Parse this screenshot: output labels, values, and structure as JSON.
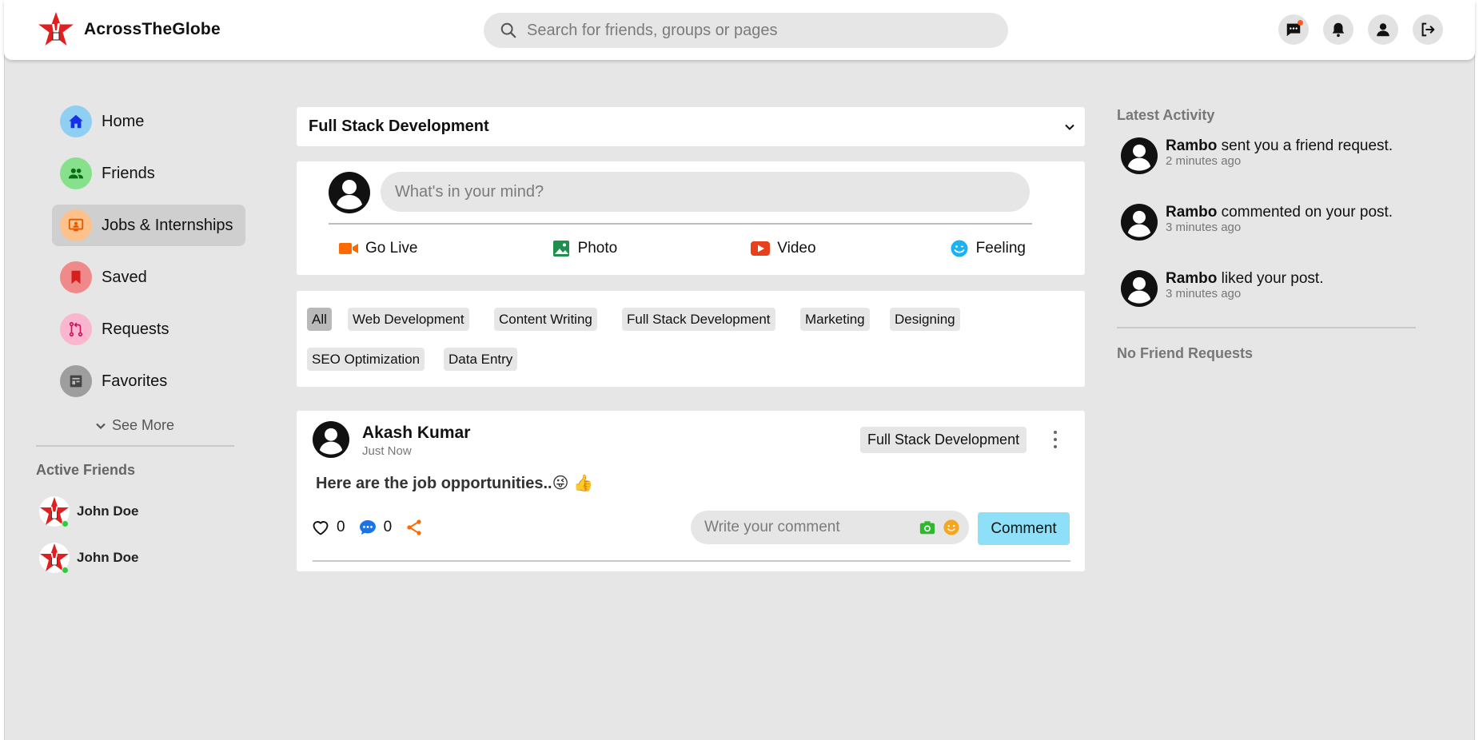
{
  "brand": {
    "name": "AcrossTheGlobe"
  },
  "search": {
    "placeholder": "Search for friends, groups or pages"
  },
  "top_icons": [
    "messages-icon",
    "bell-icon",
    "user-icon",
    "logout-icon"
  ],
  "colors": {
    "background": "#e6e6e6",
    "accent_comment": "#8de0f7",
    "go_live": "#ff6a00",
    "photo": "#1f8f4e",
    "video": "#e8401c",
    "feeling": "#1ab2f5",
    "share": "#ff6a00",
    "comment_icon": "#1a73e8",
    "online": "#2ecc40"
  },
  "nav": {
    "items": [
      {
        "label": "Home",
        "icon": "home-icon"
      },
      {
        "label": "Friends",
        "icon": "friends-icon"
      },
      {
        "label": "Jobs & Internships",
        "icon": "jobs-icon",
        "active": true
      },
      {
        "label": "Saved",
        "icon": "bookmark-icon"
      },
      {
        "label": "Requests",
        "icon": "requests-icon"
      },
      {
        "label": "Favorites",
        "icon": "favorites-icon"
      }
    ],
    "see_more": "See More"
  },
  "active_friends": {
    "title": "Active Friends",
    "friends": [
      {
        "name": "John Doe",
        "online": true
      },
      {
        "name": "John Doe",
        "online": true
      }
    ]
  },
  "feed": {
    "selected_category": "Full Stack Development",
    "composer": {
      "placeholder": "What's in your mind?",
      "actions": [
        "Go Live",
        "Photo",
        "Video",
        "Feeling"
      ]
    },
    "tags": [
      "All",
      "Web Development",
      "Content Writing",
      "Full Stack Development",
      "Marketing",
      "Designing",
      "SEO Optimization",
      "Data Entry"
    ],
    "active_tag": "All",
    "post": {
      "author": "Akash Kumar",
      "time": "Just Now",
      "tag": "Full Stack Development",
      "text": "Here are the job opportunities..😜 👍",
      "likes": "0",
      "comments": "0",
      "comment_placeholder": "Write your comment",
      "comment_button": "Comment"
    }
  },
  "activity": {
    "title": "Latest Activity",
    "items": [
      {
        "name": "Rambo",
        "text": " sent you a friend request.",
        "time": "2 minutes ago"
      },
      {
        "name": "Rambo",
        "text": " commented on your post.",
        "time": "3 minutes ago"
      },
      {
        "name": "Rambo",
        "text": " liked your post.",
        "time": "3 minutes ago"
      }
    ],
    "no_requests": "No Friend Requests"
  }
}
